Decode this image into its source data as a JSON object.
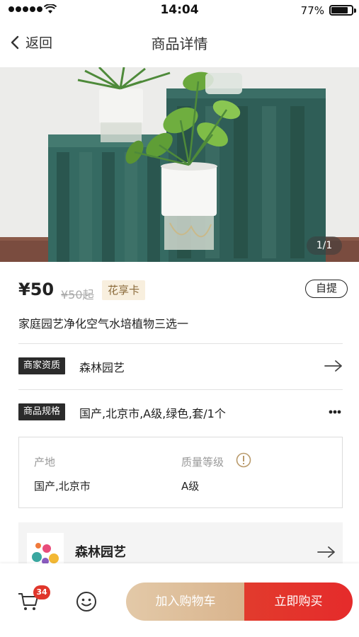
{
  "status_bar": {
    "time": "14:04",
    "battery_percent": "77%",
    "battery_level": 0.77,
    "signal_bars": 5,
    "icons": [
      "signal-icon",
      "wifi-icon",
      "battery-icon"
    ]
  },
  "nav": {
    "back_label": "返回",
    "title": "商品详情",
    "back_icon": "chevron-left-icon"
  },
  "gallery": {
    "pager": "1/1"
  },
  "product": {
    "price": "¥50",
    "original_price": "¥50起",
    "card_tag": "花享卡",
    "pickup_tag": "自提",
    "name": "家庭园艺净化空气水培植物三选一"
  },
  "merchant_row": {
    "tag": "商家资质",
    "value": "森林园艺",
    "icon": "arrow-right-icon"
  },
  "spec_row": {
    "tag": "商品规格",
    "value": "国产,北京市,A级,绿色,套/1个",
    "icon": "more-icon"
  },
  "spec_box": {
    "origin_label": "产地",
    "origin_value": "国产,北京市",
    "grade_label": "质量等级",
    "grade_value": "A级",
    "grade_icon": "info-icon"
  },
  "shop": {
    "name": "森林园艺",
    "logo_icon": "shop-logo-icon",
    "arrow_icon": "arrow-right-icon"
  },
  "bottom_bar": {
    "cart_count": "34",
    "cart_icon": "cart-icon",
    "service_icon": "customer-service-icon",
    "add_to_cart": "加入购物车",
    "buy_now": "立即购买"
  },
  "colors": {
    "accent_red": "#e23b2d",
    "accent_gold": "#d9b48d",
    "tag_dark": "#2b2b2b",
    "card_tag_bg": "#f8efde"
  }
}
